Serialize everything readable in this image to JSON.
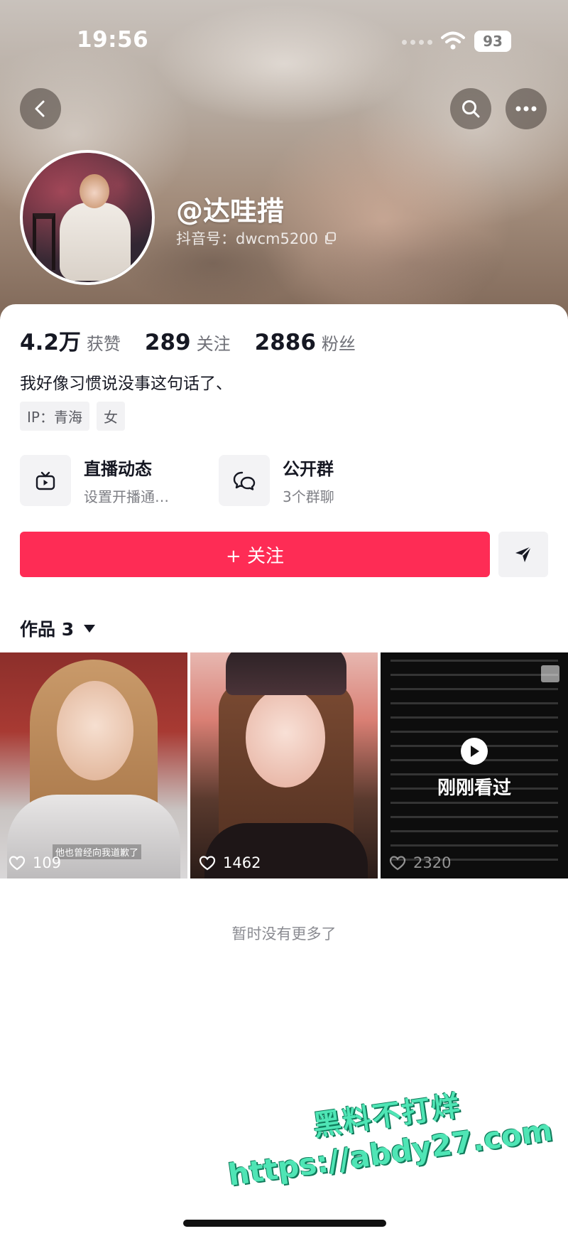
{
  "status_bar": {
    "time": "19:56",
    "battery": "93"
  },
  "header": {
    "back_icon": "chevron-left-icon",
    "search_icon": "search-icon",
    "more_icon": "more-dots-icon"
  },
  "profile": {
    "nickname": "@达哇措",
    "douyin_id": "抖音号：dwcm5200",
    "stats": [
      {
        "number": "4.2万",
        "label": "获赞"
      },
      {
        "number": "289",
        "label": "关注"
      },
      {
        "number": "2886",
        "label": "粉丝"
      }
    ],
    "bio": "我好像习惯说没事这句话了、",
    "tags": [
      "IP：青海",
      "女"
    ]
  },
  "quick_links": [
    {
      "title": "直播动态",
      "subtitle": "设置开播通…",
      "icon": "live-tv-icon"
    },
    {
      "title": "公开群",
      "subtitle": "3个群聊",
      "icon": "group-chat-icon"
    }
  ],
  "actions": {
    "follow_label": "+ 关注",
    "share_icon": "send-icon"
  },
  "works": {
    "tab_label": "作品 3",
    "items": [
      {
        "likes": "109",
        "caption": "他也曾经向我道歉了"
      },
      {
        "likes": "1462"
      },
      {
        "likes": "2320",
        "overlay_text": "刚刚看过"
      }
    ],
    "footer": "暂时没有更多了"
  },
  "watermark": {
    "line1": "黑料不打烊",
    "line2": "https://abdy27.com"
  },
  "colors": {
    "follow_button": "#fe2c55",
    "watermark": "#4fe5b5"
  }
}
